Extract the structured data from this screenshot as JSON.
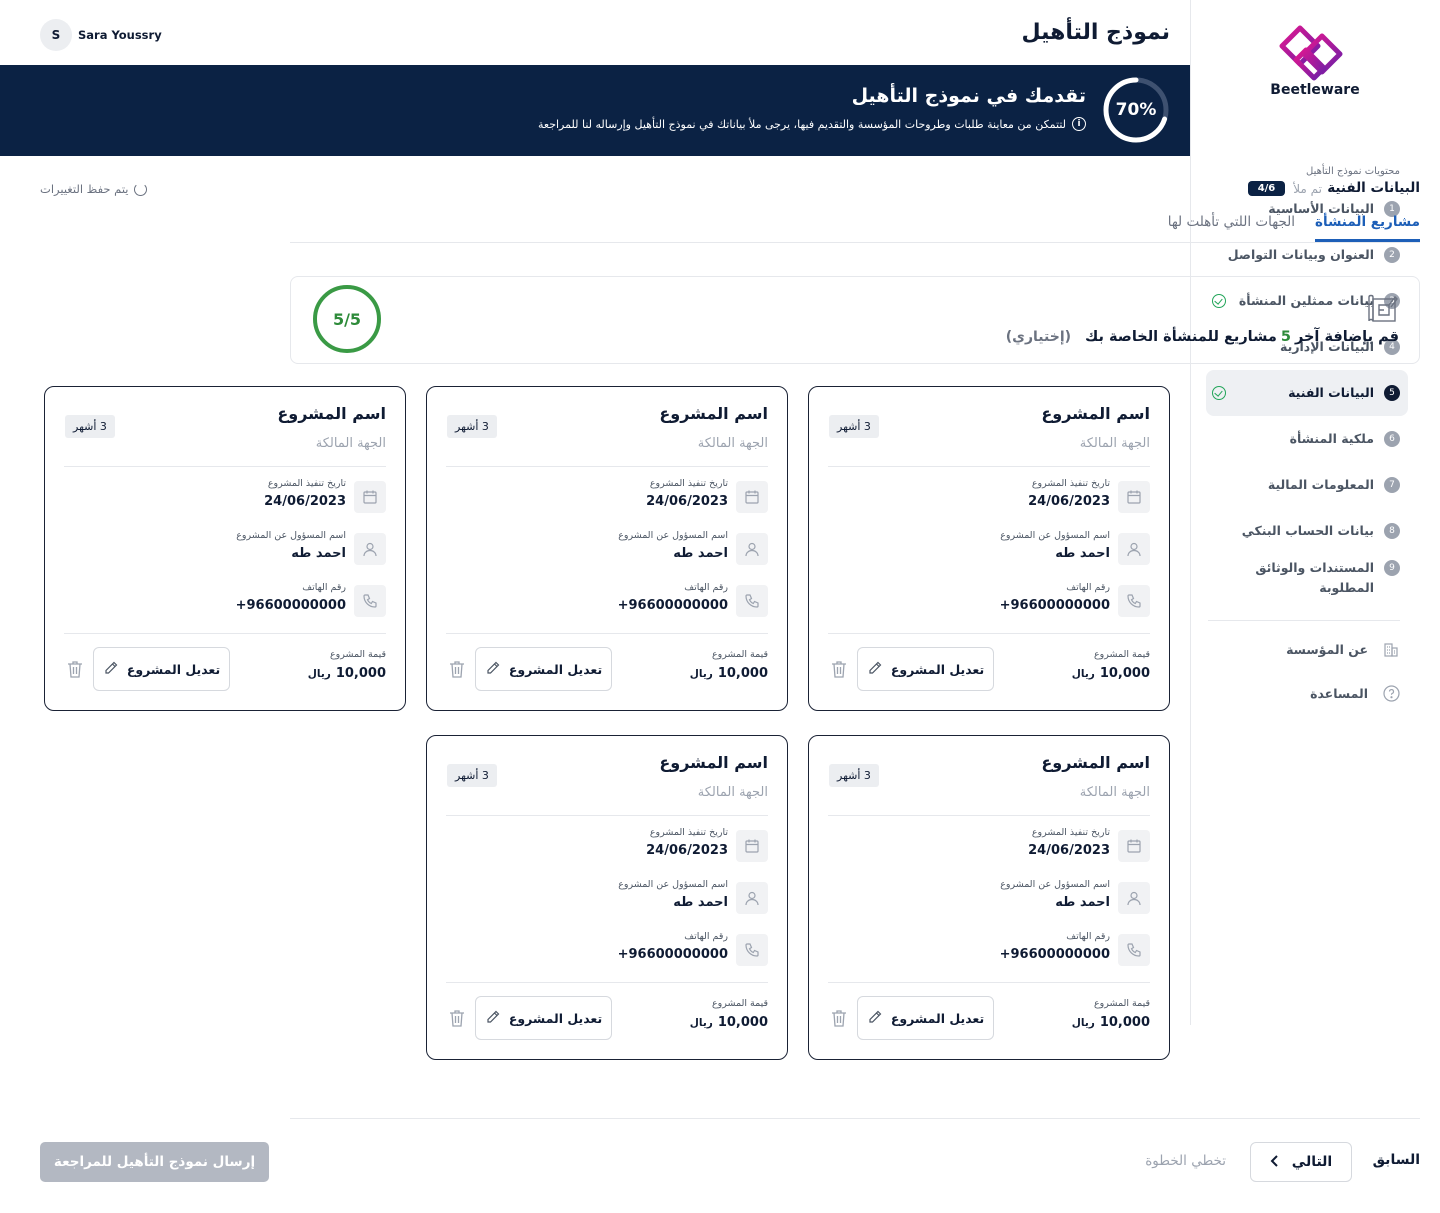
{
  "header": {
    "page_title": "نموذج التأهيل",
    "user_name": "Sara Youssry",
    "user_initial": "S"
  },
  "banner": {
    "progress_percent": 70,
    "progress_label": "70%",
    "title": "تقدمك في نموذج التأهيل",
    "subtitle": "لتتمكن من معاينة طلبات وطروحات المؤسسة والتقديم فيها، يرجى ملأ بياناتك في نموذج التأهيل وإرساله لنا للمراجعة",
    "info_icon": "info-icon"
  },
  "sidebar": {
    "logo_text": "Beetleware",
    "heading": "محتويات نموذج التأهيل",
    "items": [
      {
        "num": "1",
        "label": "البيانات الأساسية",
        "checked": false,
        "active": false
      },
      {
        "num": "2",
        "label": "العنوان وبيانات التواصل",
        "checked": false,
        "active": false
      },
      {
        "num": "3",
        "label": "بيانات ممثلين المنشأة",
        "checked": true,
        "active": false
      },
      {
        "num": "4",
        "label": "البيانات الإدارية",
        "checked": false,
        "active": false
      },
      {
        "num": "5",
        "label": "البيانات الفنية",
        "checked": true,
        "active": true
      },
      {
        "num": "6",
        "label": "ملكية المنشأة",
        "checked": false,
        "active": false
      },
      {
        "num": "7",
        "label": "المعلومات المالية",
        "checked": false,
        "active": false
      },
      {
        "num": "8",
        "label": "بيانات الحساب البنكي",
        "checked": false,
        "active": false
      },
      {
        "num": "9",
        "label": "المستندات والوثائق المطلوبة",
        "checked": false,
        "active": false
      }
    ],
    "about_label": "عن المؤسسة",
    "help_label": "المساعدة",
    "about_icon": "building-icon",
    "help_icon": "question-icon"
  },
  "section": {
    "title": "البيانات الفنية",
    "filled_label": "تم ملأ",
    "filled_count": "4/6",
    "saving_label": "يتم حفظ التغييرات",
    "tabs": [
      "مشاريع المنشأة",
      "الجهات اللتي تأهلت لها"
    ]
  },
  "add_box": {
    "prefix": "قم بإضافة آخر",
    "count": "5",
    "suffix": "مشاريع للمنشأة الخاصة بك",
    "optional": "(إختياري)",
    "ring_label": "5/5",
    "icon": "blueprint-icon"
  },
  "project_labels": {
    "date_label": "تاريخ تنفيذ المشروع",
    "manager_label": "اسم المسؤول عن المشروع",
    "phone_label": "رقم الهاتف",
    "price_label": "قيمة المشروع",
    "currency": "ريال",
    "edit_label": "تعديل المشروع"
  },
  "projects": [
    {
      "title": "اسم المشروع",
      "owner": "الجهة المالكة",
      "duration": "3 أشهر",
      "date": "24/06/2023",
      "manager": "احمد طه",
      "phone": "+96600000000",
      "price": "10,000"
    },
    {
      "title": "اسم المشروع",
      "owner": "الجهة المالكة",
      "duration": "3 أشهر",
      "date": "24/06/2023",
      "manager": "احمد طه",
      "phone": "+96600000000",
      "price": "10,000"
    },
    {
      "title": "اسم المشروع",
      "owner": "الجهة المالكة",
      "duration": "3 أشهر",
      "date": "24/06/2023",
      "manager": "احمد طه",
      "phone": "+96600000000",
      "price": "10,000"
    },
    {
      "title": "اسم المشروع",
      "owner": "الجهة المالكة",
      "duration": "3 أشهر",
      "date": "24/06/2023",
      "manager": "احمد طه",
      "phone": "+96600000000",
      "price": "10,000"
    },
    {
      "title": "اسم المشروع",
      "owner": "الجهة المالكة",
      "duration": "3 أشهر",
      "date": "24/06/2023",
      "manager": "احمد طه",
      "phone": "+96600000000",
      "price": "10,000"
    }
  ],
  "footer": {
    "prev_label": "السابق",
    "next_label": "التالي",
    "skip_label": "تخطي الخطوة",
    "submit_label": "إرسال نموذج التأهيل للمراجعة"
  },
  "colors": {
    "navy": "#0b2244",
    "accent_blue": "#1d5fb8",
    "success_green": "#2e8b3a",
    "disabled_gray": "#b3b8c2"
  }
}
